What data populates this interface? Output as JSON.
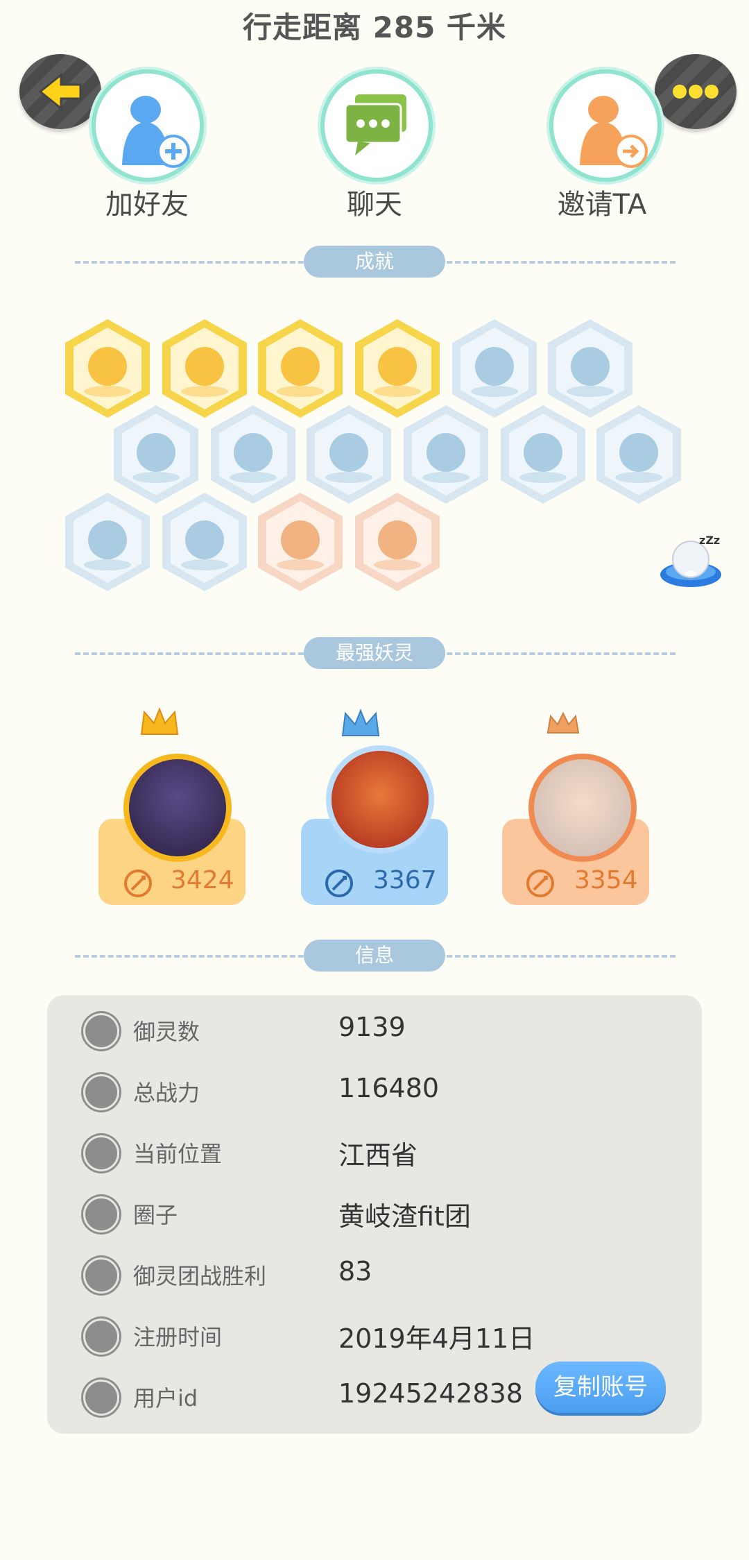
{
  "header": {
    "title": "行走距离 285 千米"
  },
  "actions": [
    {
      "label": "加好友",
      "icon": "add-friend-icon"
    },
    {
      "label": "聊天",
      "icon": "chat-icon"
    },
    {
      "label": "邀请TA",
      "icon": "invite-icon"
    }
  ],
  "sections": {
    "achievements": "成就",
    "strongest": "最强妖灵",
    "info": "信息"
  },
  "achievements": [
    {
      "icon": "fox-emblem-icon",
      "tier": "gold"
    },
    {
      "icon": "gourd-emblem-icon",
      "tier": "gold"
    },
    {
      "icon": "yinyang-swirl-icon",
      "tier": "gold"
    },
    {
      "icon": "yinyang-box-icon",
      "tier": "gold"
    },
    {
      "icon": "sneaker-icon",
      "tier": "blue"
    },
    {
      "icon": "orb-staff-icon",
      "tier": "blue"
    },
    {
      "icon": "moon-planet-icon",
      "tier": "blue"
    },
    {
      "icon": "crystal-icon",
      "tier": "blue"
    },
    {
      "icon": "spirit-figure-icon",
      "tier": "blue"
    },
    {
      "icon": "cat-spirit-icon",
      "tier": "blue"
    },
    {
      "icon": "dragon-icon",
      "tier": "blue"
    },
    {
      "icon": "shield-orb-icon",
      "tier": "blue"
    },
    {
      "icon": "ghost-cat-icon",
      "tier": "blue"
    },
    {
      "icon": "book-fox-icon",
      "tier": "blue"
    },
    {
      "icon": "stroller-icon",
      "tier": "orange"
    },
    {
      "icon": "demon-statue-icon",
      "tier": "orange"
    }
  ],
  "top_sprites": [
    {
      "power": "3424",
      "color": "#fcd484",
      "avatar": "#3a3060",
      "crown": "#f6b81e"
    },
    {
      "power": "3367",
      "color": "#a8d4f8",
      "avatar": "#d45a2a",
      "crown": "#5aa8e8"
    },
    {
      "power": "3354",
      "color": "#fcc69c",
      "avatar": "#f0b890",
      "crown": "#f0a060"
    }
  ],
  "info": {
    "rows": [
      {
        "icon": "spirit-count-icon",
        "label": "御灵数",
        "value": "9139"
      },
      {
        "icon": "sword-icon",
        "label": "总战力",
        "value": "116480"
      },
      {
        "icon": "location-pin-icon",
        "label": "当前位置",
        "value": "江西省"
      },
      {
        "icon": "circle-target-icon",
        "label": "圈子",
        "value": "黄岐渣fit团"
      },
      {
        "icon": "team-victory-icon",
        "label": "御灵团战胜利",
        "value": "83"
      },
      {
        "icon": "clock-icon",
        "label": "注册时间",
        "value": "2019年4月11日"
      },
      {
        "icon": "id-card-icon",
        "label": "用户id",
        "value": "19245242838"
      }
    ],
    "copy_button": "复制账号"
  }
}
